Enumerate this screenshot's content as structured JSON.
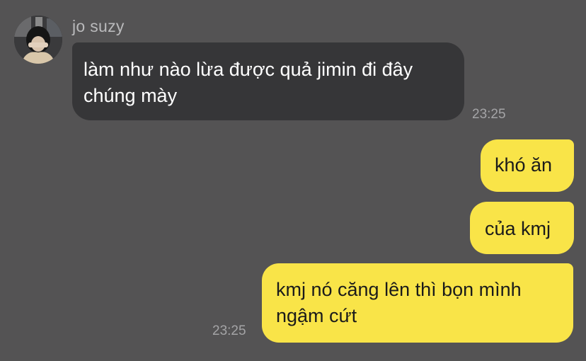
{
  "incoming": {
    "sender_name": "jo suzy",
    "avatar_icon": "profile-photo",
    "message": "làm như nào lừa được quả jimin đi đây chúng mày",
    "time": "23:25"
  },
  "outgoing": {
    "messages": [
      "khó ăn",
      "của kmj",
      "kmj nó căng lên thì bọn mình ngậm cứt"
    ],
    "time": "23:25"
  },
  "colors": {
    "background": "#545354",
    "incoming_bubble": "#363638",
    "outgoing_bubble": "#f9e448",
    "timestamp": "#a4a4a6"
  }
}
